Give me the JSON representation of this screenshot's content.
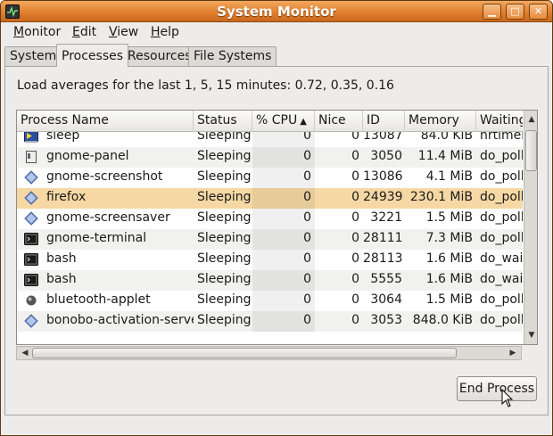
{
  "window": {
    "title": "System Monitor"
  },
  "menubar": {
    "items": [
      {
        "label": "Monitor",
        "mnemonic": "M",
        "rest": "onitor"
      },
      {
        "label": "Edit",
        "mnemonic": "E",
        "rest": "dit"
      },
      {
        "label": "View",
        "mnemonic": "V",
        "rest": "iew"
      },
      {
        "label": "Help",
        "mnemonic": "H",
        "rest": "elp"
      }
    ]
  },
  "tabs": [
    {
      "label": "System",
      "active": false
    },
    {
      "label": "Processes",
      "active": true
    },
    {
      "label": "Resources",
      "active": false
    },
    {
      "label": "File Systems",
      "active": false
    }
  ],
  "load_averages": "Load averages for the last 1, 5, 15 minutes: 0.72, 0.35, 0.16",
  "table": {
    "columns": [
      "Process Name",
      "Status",
      "% CPU",
      "Nice",
      "ID",
      "Memory",
      "Waiting"
    ],
    "sort_indicator": "^",
    "rows": [
      {
        "name": "sleep",
        "status": "Sleeping",
        "cpu": "0",
        "nice": "0",
        "id": "13087",
        "memory": "84.0 KiB",
        "waiting": "hrtimer",
        "icon": "terminal-app-icon"
      },
      {
        "name": "gnome-panel",
        "status": "Sleeping",
        "cpu": "0",
        "nice": "0",
        "id": "3050",
        "memory": "11.4 MiB",
        "waiting": "do_poll",
        "icon": "panel-icon"
      },
      {
        "name": "gnome-screenshot",
        "status": "Sleeping",
        "cpu": "0",
        "nice": "0",
        "id": "13086",
        "memory": "4.1 MiB",
        "waiting": "do_poll",
        "icon": "diamond-icon"
      },
      {
        "name": "firefox",
        "status": "Sleeping",
        "cpu": "0",
        "nice": "0",
        "id": "24939",
        "memory": "230.1 MiB",
        "waiting": "do_poll",
        "icon": "diamond-icon"
      },
      {
        "name": "gnome-screensaver",
        "status": "Sleeping",
        "cpu": "0",
        "nice": "0",
        "id": "3221",
        "memory": "1.5 MiB",
        "waiting": "do_poll",
        "icon": "diamond-icon"
      },
      {
        "name": "gnome-terminal",
        "status": "Sleeping",
        "cpu": "0",
        "nice": "0",
        "id": "28111",
        "memory": "7.3 MiB",
        "waiting": "do_poll",
        "icon": "terminal-icon"
      },
      {
        "name": "bash",
        "status": "Sleeping",
        "cpu": "0",
        "nice": "0",
        "id": "28113",
        "memory": "1.6 MiB",
        "waiting": "do_wait",
        "icon": "terminal-icon"
      },
      {
        "name": "bash",
        "status": "Sleeping",
        "cpu": "0",
        "nice": "0",
        "id": "5555",
        "memory": "1.6 MiB",
        "waiting": "do_wait",
        "icon": "terminal-icon"
      },
      {
        "name": "bluetooth-applet",
        "status": "Sleeping",
        "cpu": "0",
        "nice": "0",
        "id": "3064",
        "memory": "1.5 MiB",
        "waiting": "do_poll",
        "icon": "bluetooth-icon"
      },
      {
        "name": "bonobo-activation-server",
        "status": "Sleeping",
        "cpu": "0",
        "nice": "0",
        "id": "3053",
        "memory": "848.0 KiB",
        "waiting": "do_poll",
        "icon": "diamond-icon"
      }
    ],
    "selected_index": 3
  },
  "end_button": {
    "label": "End Process"
  },
  "colors": {
    "titlebar": "#e0802f",
    "selection": "#f6d8a4"
  }
}
